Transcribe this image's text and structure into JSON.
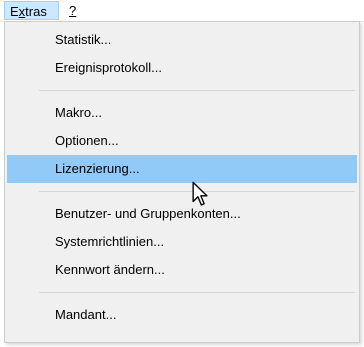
{
  "menubar": {
    "items": [
      {
        "label": "Extras",
        "accel": "x",
        "active": true
      },
      {
        "label": "?",
        "accel": "?",
        "active": false
      }
    ]
  },
  "menu": {
    "items": [
      {
        "label": "Statistik..."
      },
      {
        "label": "Ereignisprotokoll..."
      },
      {
        "label": "Makro..."
      },
      {
        "label": "Optionen..."
      },
      {
        "label": "Lizenzierung...",
        "highlighted": true
      },
      {
        "label": "Benutzer- und Gruppenkonten..."
      },
      {
        "label": "Systemrichtlinien..."
      },
      {
        "label": "Kennwort ändern..."
      },
      {
        "label": "Mandant..."
      }
    ]
  },
  "colors": {
    "highlight": "#91c9f7",
    "menubar_active": "#cce8ff",
    "menu_background": "#f0f0f0"
  },
  "icons": {
    "cursor": "mouse-pointer-icon"
  }
}
